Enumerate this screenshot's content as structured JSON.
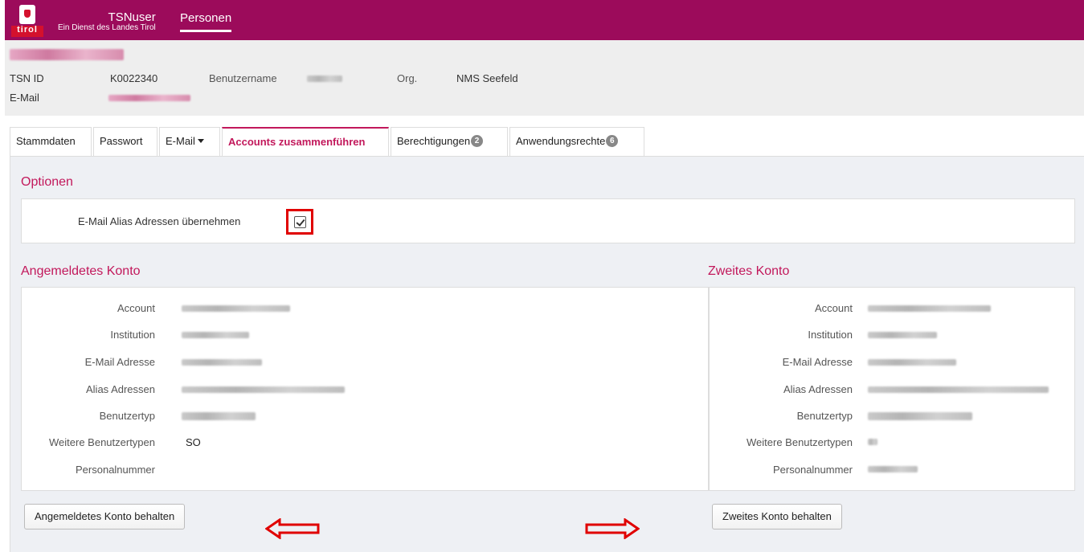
{
  "header": {
    "logo_text": "tirol",
    "brand_title": "TSNuser",
    "brand_subtitle": "Ein Dienst des Landes Tirol",
    "nav_item": "Personen"
  },
  "user": {
    "tsn_id_label": "TSN ID",
    "tsn_id_value": "K0022340",
    "username_label": "Benutzername",
    "org_label": "Org.",
    "org_value": "NMS Seefeld",
    "email_label": "E-Mail"
  },
  "tabs": [
    {
      "label": "Stammdaten"
    },
    {
      "label": "Passwort"
    },
    {
      "label": "E-Mail"
    },
    {
      "label": "Accounts zusammenführen"
    },
    {
      "label": "Berechtigungen",
      "badge": "2"
    },
    {
      "label": "Anwendungsrechte",
      "badge": "6"
    }
  ],
  "options": {
    "title": "Optionen",
    "alias_label": "E-Mail Alias Adressen übernehmen",
    "alias_checked": true
  },
  "left": {
    "title": "Angemeldetes Konto",
    "labels": [
      "Account",
      "Institution",
      "E-Mail Adresse",
      "Alias Adressen",
      "Benutzertyp",
      "Weitere Benutzertypen",
      "Personalnummer"
    ],
    "weitere_value": "SO",
    "button": "Angemeldetes Konto behalten"
  },
  "right": {
    "title": "Zweites Konto",
    "labels": [
      "Account",
      "Institution",
      "E-Mail Adresse",
      "Alias Adressen",
      "Benutzertyp",
      "Weitere Benutzertypen",
      "Personalnummer"
    ],
    "button": "Zweites Konto behalten"
  },
  "colors": {
    "brand": "#9c0b5b",
    "accent": "#c2185b",
    "highlight": "#e00000"
  }
}
